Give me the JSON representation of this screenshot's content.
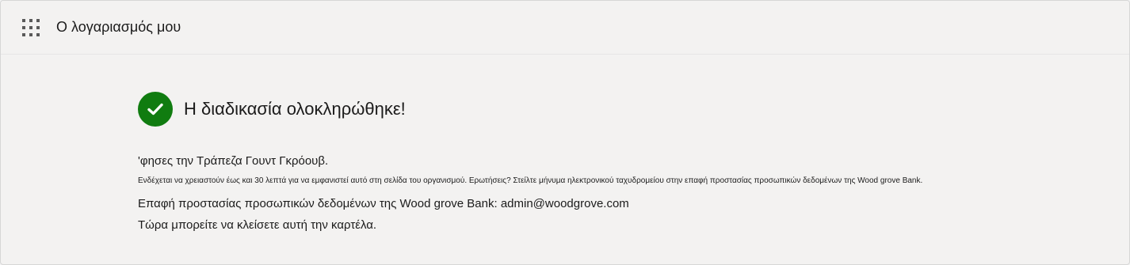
{
  "header": {
    "app_launcher_icon": "waffle-grid-icon",
    "title": "Ο λογαριασμός μου"
  },
  "status": {
    "icon": "checkmark-circle-icon",
    "icon_color": "#107c10",
    "title": "Η διαδικασία ολοκληρώθηκε!"
  },
  "messages": {
    "line1": "'φησες την Τράπεζα Γουντ Γκρόουβ.",
    "line2": "Ενδέχεται να χρειαστούν έως και 30 λεπτά για να εμφανιστεί αυτό στη σελίδα του οργανισμού. Ερωτήσεις? Στείλτε μήνυμα ηλεκτρονικού ταχυδρομείου στην επαφή προστασίας προσωπικών δεδομένων της Wood grove Bank.",
    "contact": "Επαφή προστασίας προσωπικών δεδομένων της Wood grove Bank: admin@woodgrove.com",
    "close_hint": "Τώρα μπορείτε να κλείσετε αυτή την καρτέλα."
  }
}
